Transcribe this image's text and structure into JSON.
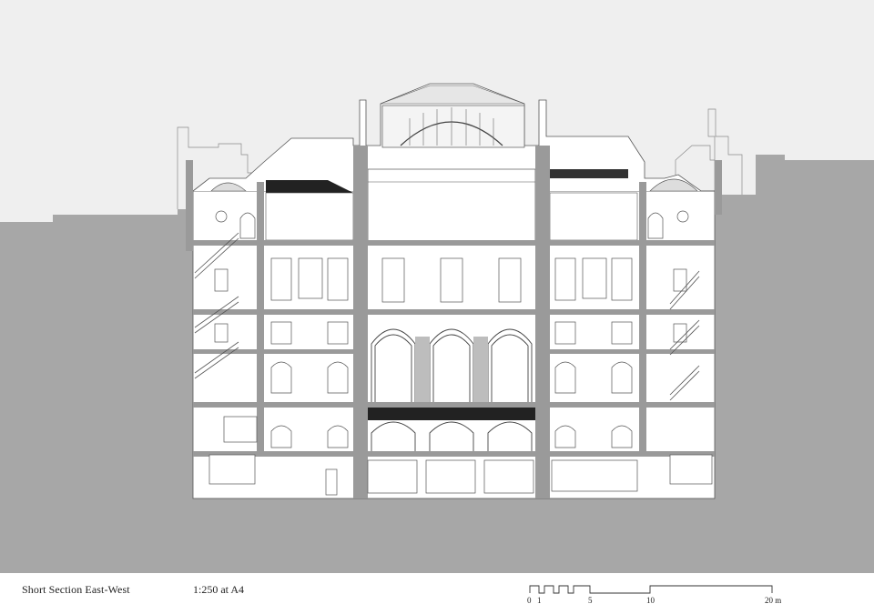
{
  "footer": {
    "title": "Short Section East-West",
    "scale": "1:250 at A4"
  },
  "scalebar": {
    "labels": [
      "0",
      "1",
      "5",
      "10",
      "20 m"
    ]
  },
  "colors": {
    "sky": "#efefef",
    "ground": "#a7a7a7",
    "paper": "#ffffff",
    "line": "#555555",
    "wall": "#9a9a9a",
    "dark": "#222222"
  }
}
